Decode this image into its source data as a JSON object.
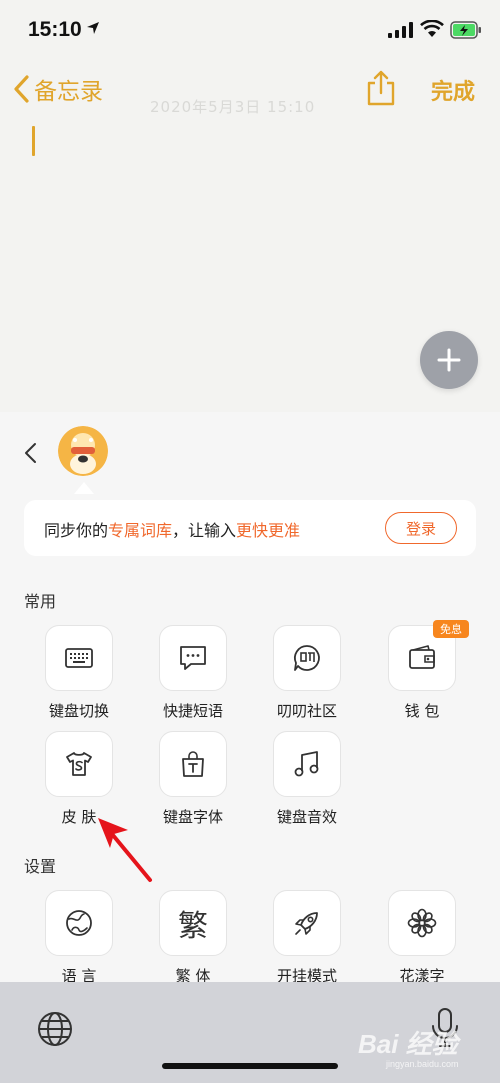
{
  "status_bar": {
    "time": "15:10"
  },
  "notes_nav": {
    "back_label": "备忘录",
    "done_label": "完成",
    "date_text": "2020年5月3日 15:10"
  },
  "sync_card": {
    "part1": "同步你的",
    "part2": "专属词库",
    "part3": "，让输入",
    "part4": "更快更准",
    "login_label": "登录"
  },
  "sections": {
    "common_title": "常用",
    "settings_title": "设置"
  },
  "common_items": [
    {
      "label": "键盘切换",
      "icon": "keyboard-icon"
    },
    {
      "label": "快捷短语",
      "icon": "chat-bubble-icon"
    },
    {
      "label": "叨叨社区",
      "icon": "community-icon"
    },
    {
      "label": "钱 包",
      "icon": "wallet-icon",
      "badge": "免息"
    },
    {
      "label": "皮 肤",
      "icon": "tshirt-icon"
    },
    {
      "label": "键盘字体",
      "icon": "font-bag-icon"
    },
    {
      "label": "键盘音效",
      "icon": "music-note-icon"
    }
  ],
  "settings_items": [
    {
      "label": "语 言",
      "icon": "globe-icon"
    },
    {
      "label": "繁 体",
      "icon": "traditional-char-icon",
      "glyph": "繁"
    },
    {
      "label": "开挂模式",
      "icon": "rocket-icon"
    },
    {
      "label": "花漾字",
      "icon": "flower-icon"
    }
  ],
  "watermark": {
    "text": "Bai 经验",
    "sub": "jingyan.baidu.com"
  },
  "colors": {
    "accent": "#e0a52c",
    "highlight": "#f0682c",
    "badge": "#f7861e",
    "arrow": "#e5141b"
  }
}
